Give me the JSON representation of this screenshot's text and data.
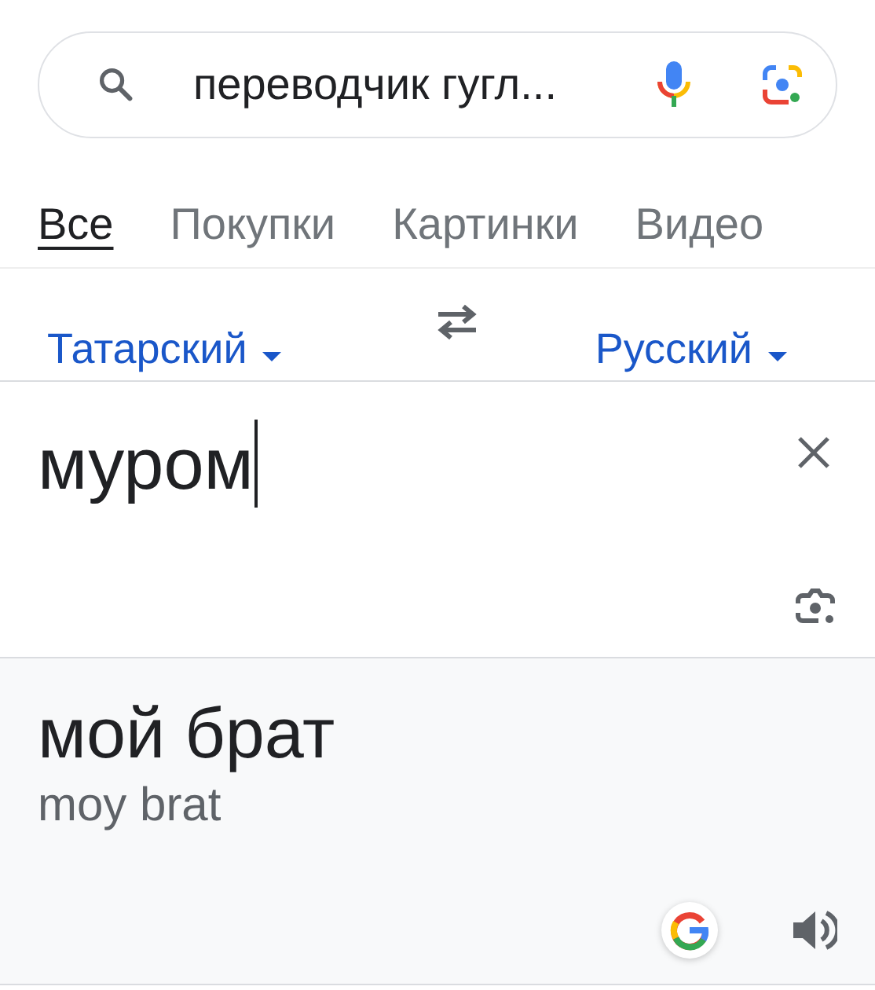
{
  "search": {
    "value": "переводчик гугл..."
  },
  "tabs": [
    {
      "label": "Все",
      "selected": true
    },
    {
      "label": "Покупки",
      "selected": false
    },
    {
      "label": "Картинки",
      "selected": false
    },
    {
      "label": "Видео",
      "selected": false
    }
  ],
  "translator": {
    "source_language": "Татарский",
    "target_language": "Русский",
    "input": "муром",
    "translation": "мой брат",
    "transliteration": "moy brat"
  }
}
